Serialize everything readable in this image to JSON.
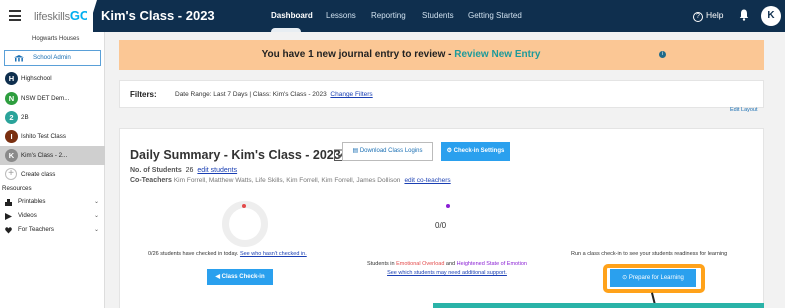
{
  "brand": {
    "logo_light": "lifeskills",
    "logo_bold": "GO",
    "class_title": "Kim's Class - 2023"
  },
  "nav": {
    "items": [
      "Dashboard",
      "Lessons",
      "Reporting",
      "Students",
      "Getting Started"
    ],
    "active": "Dashboard",
    "help_label": "Help",
    "help_glyph": "?",
    "avatar_initial": "K"
  },
  "sidebar": {
    "houses_label": "Hogwarts Houses",
    "admin_label": "School Admin",
    "classes": [
      {
        "badge": "H",
        "label": "Highschool",
        "color": "#0f2f4e"
      },
      {
        "badge": "N",
        "label": "NSW DET Dem...",
        "color": "#2e9e3f"
      },
      {
        "badge": "2",
        "label": "2B",
        "color": "#2aa39a"
      },
      {
        "badge": "I",
        "label": "Ishito Test Class",
        "color": "#7a2f10"
      },
      {
        "badge": "K",
        "label": "Kim's Class - 2...",
        "color": "#8a8a8a"
      }
    ],
    "create_label": "Create class",
    "resources_label": "Resources",
    "resources": [
      {
        "label": "Printables",
        "icon": "printables-icon"
      },
      {
        "label": "Videos",
        "icon": "play-icon"
      },
      {
        "label": "For Teachers",
        "icon": "heart-icon"
      }
    ]
  },
  "banner": {
    "text": "You have 1 new journal entry to review - ",
    "link": "Review New Entry",
    "info_glyph": "i"
  },
  "filters": {
    "label": "Filters:",
    "text": "Date Range: Last 7 Days  |  Class: Kim's Class - 2023",
    "link": "Change Filters"
  },
  "edit_layout": "Edit Layout",
  "summary": {
    "title": "Daily Summary - Kim's Class - 2023",
    "download_btn": "Download Class Logins",
    "settings_btn": "Check-in Settings",
    "students_label": "No. of Students",
    "students_count": "26",
    "edit_students": "edit students",
    "coteachers_label": "Co-Teachers",
    "coteachers_names": "Kim Forrell, Matthew Watts, Life Skills, Kim Forrell, Kim Forrell, James Dollison",
    "edit_coteachers": "edit co-teachers",
    "not_checked_text": "0/26 students have checked in today.",
    "not_checked_link": "See who hasn't checked in.",
    "class_checkin_btn": "Class Check-in",
    "emo_ratio": "0/0",
    "emo_text_1": "Students in ",
    "emo_red": "Emotional Overload",
    "emo_and": " and ",
    "emo_purple": "Heightened State of Emotion",
    "emo_link": "See which students may need additional support.",
    "readiness_text": "Run a class check-in to see your students readiness for learning",
    "prepare_btn": "Prepare for Learning"
  },
  "colors": {
    "nav": "#0f2f4e",
    "accent": "#2aa0ee",
    "banner": "#fbc795",
    "highlight": "#ffa21a",
    "teal": "#2ab3a8"
  }
}
